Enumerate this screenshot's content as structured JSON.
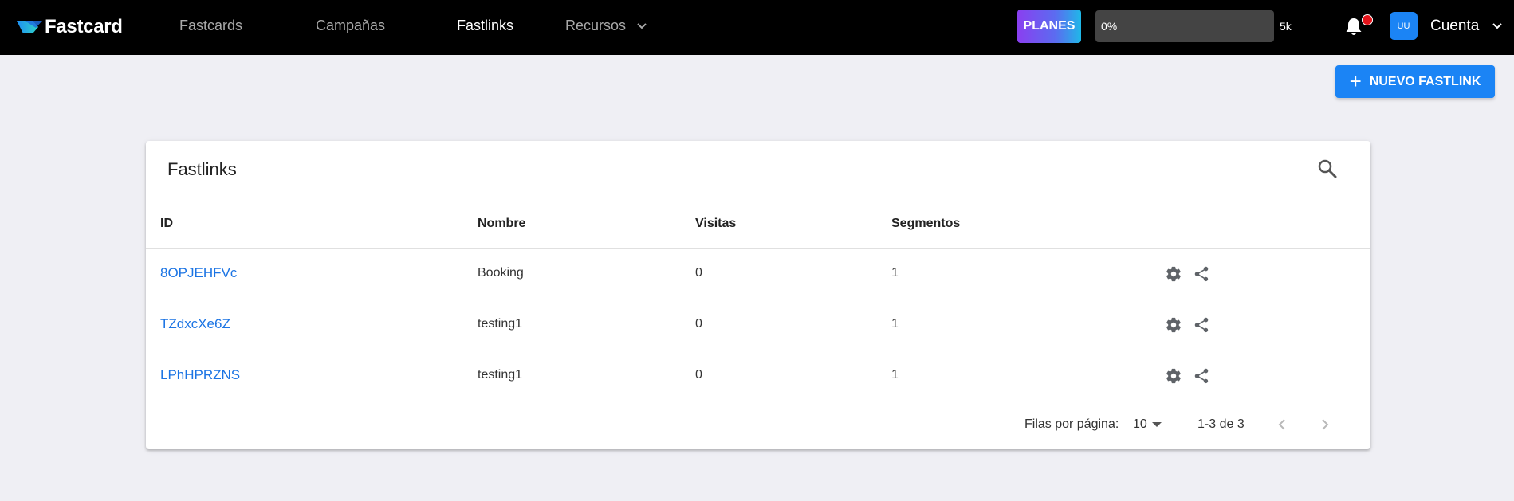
{
  "brand": {
    "name": "Fastcard"
  },
  "nav": {
    "items": [
      {
        "label": "Fastcards",
        "active": false
      },
      {
        "label": "Campañas",
        "active": false
      },
      {
        "label": "Fastlinks",
        "active": true
      },
      {
        "label": "Recursos",
        "active": false,
        "has_dropdown": true
      }
    ]
  },
  "plan": {
    "button_label": "PLANES",
    "usage_label": "0%",
    "usage_fraction": 0,
    "limit_label": "5k"
  },
  "notifications": {
    "icon": "bell-icon",
    "has_unread": true
  },
  "user": {
    "initials": "UU",
    "account_label": "Cuenta"
  },
  "actions": {
    "new_label": "NUEVO FASTLINK"
  },
  "table": {
    "title": "Fastlinks",
    "columns": [
      "ID",
      "Nombre",
      "Visitas",
      "Segmentos"
    ],
    "rows": [
      {
        "id": "8OPJEHFVc",
        "name": "Booking",
        "visits": "0",
        "segments": "1"
      },
      {
        "id": "TZdxcXe6Z",
        "name": "testing1",
        "visits": "0",
        "segments": "1"
      },
      {
        "id": "LPhHPRZNS",
        "name": "testing1",
        "visits": "0",
        "segments": "1"
      }
    ],
    "pagination": {
      "rows_per_page_label": "Filas por página:",
      "rows_per_page_value": "10",
      "range_label": "1-3 de 3"
    }
  },
  "colors": {
    "accent": "#1b84f5",
    "link": "#1b74e4",
    "topbar": "#000000",
    "background": "#efeff4",
    "notification_dot": "#e5141b"
  }
}
